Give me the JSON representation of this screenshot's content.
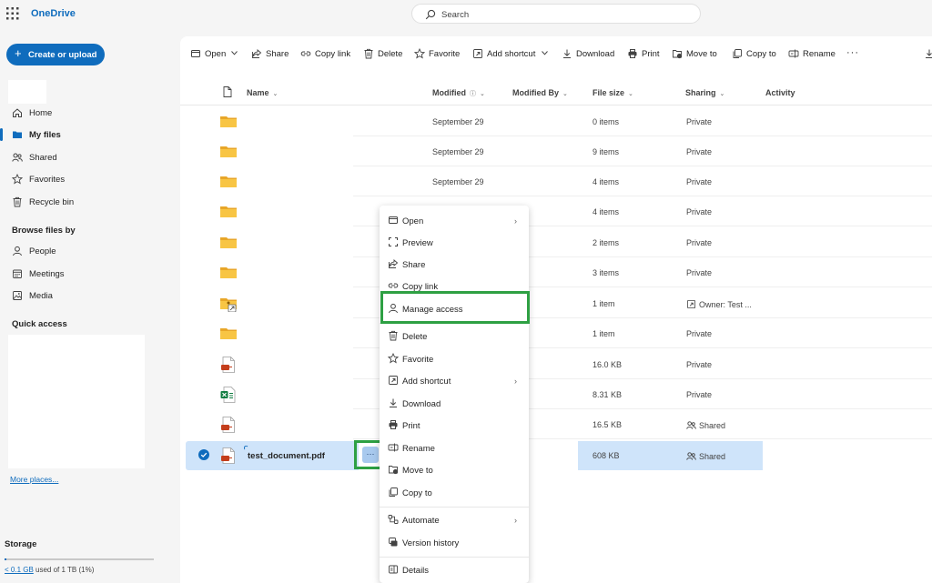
{
  "app": {
    "title": "OneDrive"
  },
  "search": {
    "placeholder": "Search"
  },
  "nav": {
    "create_label": "Create or upload",
    "items": [
      {
        "label": "Home",
        "icon": "home-icon"
      },
      {
        "label": "My files",
        "icon": "folder-icon",
        "selected": true
      },
      {
        "label": "Shared",
        "icon": "people-icon"
      },
      {
        "label": "Favorites",
        "icon": "star-icon"
      },
      {
        "label": "Recycle bin",
        "icon": "trash-icon"
      }
    ],
    "browse_heading": "Browse files by",
    "browse_items": [
      {
        "label": "People",
        "icon": "person-icon"
      },
      {
        "label": "Meetings",
        "icon": "calendar-icon"
      },
      {
        "label": "Media",
        "icon": "image-icon"
      }
    ],
    "quick_access_heading": "Quick access",
    "more_places": "More places...",
    "storage": {
      "title": "Storage",
      "used": "< 0.1 GB",
      "suffix": "used of 1 TB (1%)",
      "fraction": 0.01
    }
  },
  "toolbar": {
    "open": "Open",
    "share": "Share",
    "copy_link": "Copy link",
    "delete": "Delete",
    "favorite": "Favorite",
    "add_shortcut": "Add shortcut",
    "download": "Download",
    "print": "Print",
    "move_to": "Move to",
    "copy_to": "Copy to",
    "rename": "Rename",
    "more": "···"
  },
  "columns": {
    "name": "Name",
    "modified": "Modified",
    "modified_by": "Modified By",
    "file_size": "File size",
    "sharing": "Sharing",
    "activity": "Activity"
  },
  "rows": [
    {
      "type": "folder",
      "modified": "September 29",
      "size": "0 items",
      "sharing": "Private"
    },
    {
      "type": "folder",
      "modified": "September 29",
      "size": "9 items",
      "sharing": "Private"
    },
    {
      "type": "folder",
      "modified": "September 29",
      "size": "4 items",
      "sharing": "Private"
    },
    {
      "type": "folder",
      "modified": "",
      "size": "4 items",
      "sharing": "Private"
    },
    {
      "type": "folder",
      "modified": "",
      "size": "2 items",
      "sharing": "Private"
    },
    {
      "type": "folder",
      "modified": "",
      "size": "3 items",
      "sharing": "Private"
    },
    {
      "type": "shared-folder",
      "modified": "",
      "size": "1 item",
      "sharing": "Owner: Test ..."
    },
    {
      "type": "folder",
      "modified": "",
      "size": "1 item",
      "sharing": "Private"
    },
    {
      "type": "pdf",
      "modified": "",
      "size": "16.0 KB",
      "sharing": "Private"
    },
    {
      "type": "excel",
      "modified": "",
      "size": "8.31 KB",
      "sharing": "Private"
    },
    {
      "type": "pdf",
      "modified": "",
      "size": "16.5 KB",
      "sharing": "Shared"
    },
    {
      "type": "pdf",
      "name": "test_document.pdf",
      "modified": "",
      "size": "608 KB",
      "sharing": "Shared",
      "selected": true
    }
  ],
  "context_menu": {
    "open": "Open",
    "preview": "Preview",
    "share": "Share",
    "copy_link": "Copy link",
    "manage_access": "Manage access",
    "delete": "Delete",
    "favorite": "Favorite",
    "add_shortcut": "Add shortcut",
    "download": "Download",
    "print": "Print",
    "rename": "Rename",
    "move_to": "Move to",
    "copy_to": "Copy to",
    "automate": "Automate",
    "version_history": "Version history",
    "details": "Details"
  },
  "colors": {
    "accent": "#0f6cbd",
    "selection": "#cfe4fa",
    "highlight": "#2ea043",
    "folder": "#f8c544"
  }
}
